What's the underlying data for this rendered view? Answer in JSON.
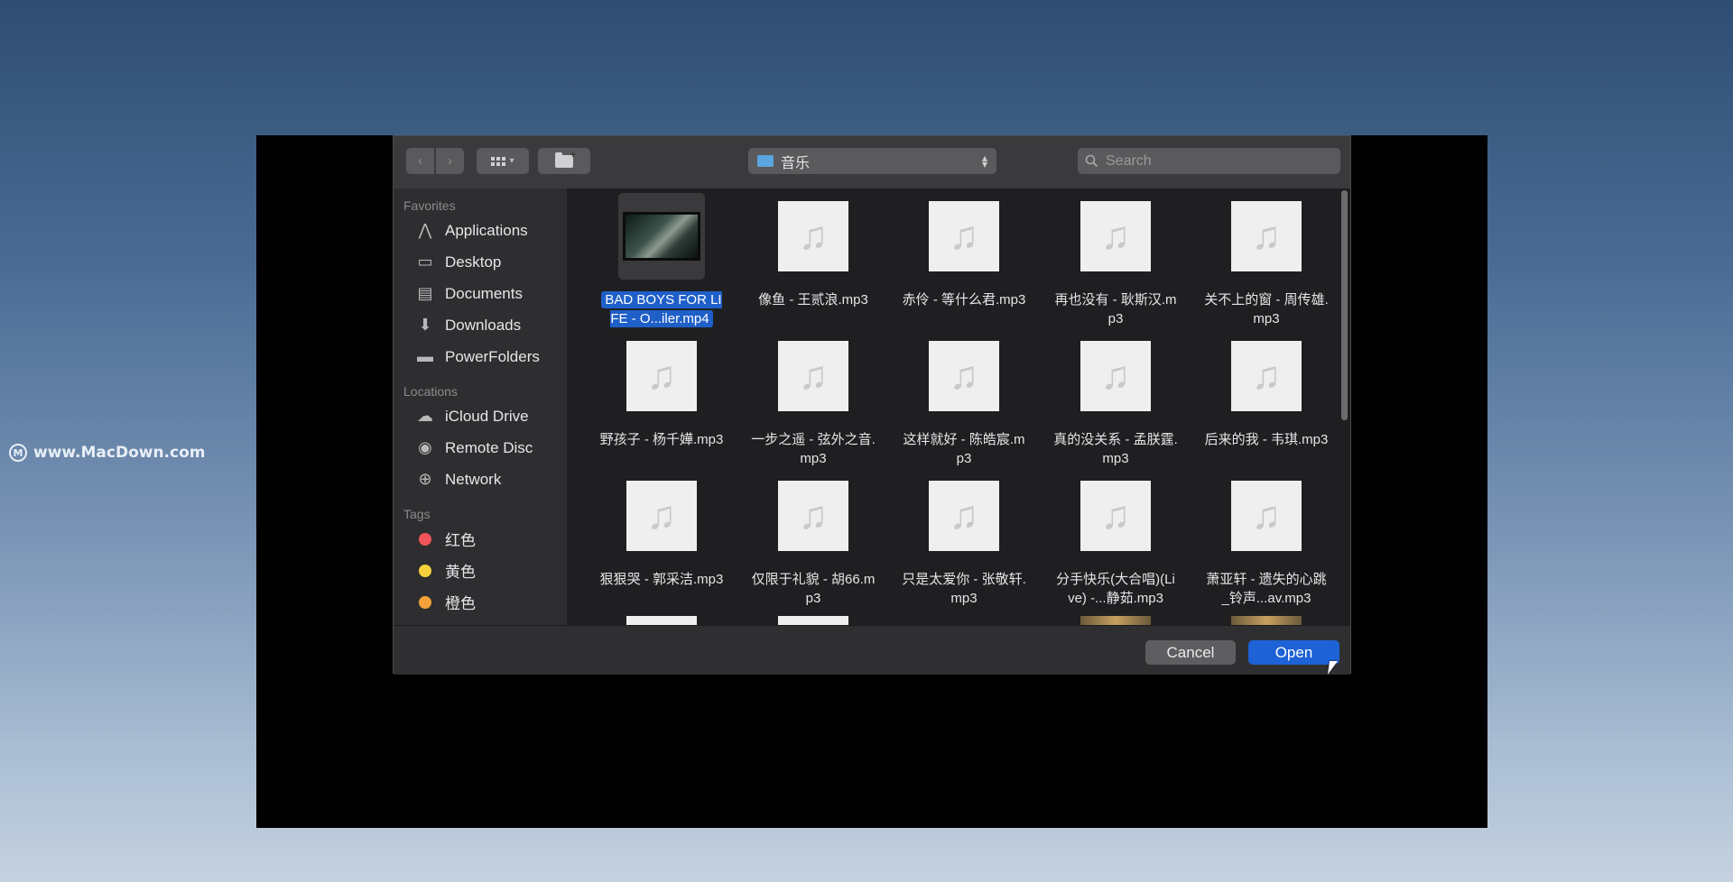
{
  "watermark": {
    "text": "www.MacDown.com"
  },
  "toolbar": {
    "path_label": "音乐",
    "search_placeholder": "Search"
  },
  "sidebar": {
    "favorites_title": "Favorites",
    "favorites": [
      {
        "label": "Applications",
        "icon": "applications-icon"
      },
      {
        "label": "Desktop",
        "icon": "desktop-icon"
      },
      {
        "label": "Documents",
        "icon": "documents-icon"
      },
      {
        "label": "Downloads",
        "icon": "downloads-icon"
      },
      {
        "label": "PowerFolders",
        "icon": "folder-icon"
      }
    ],
    "locations_title": "Locations",
    "locations": [
      {
        "label": "iCloud Drive",
        "icon": "cloud-icon"
      },
      {
        "label": "Remote Disc",
        "icon": "disc-icon"
      },
      {
        "label": "Network",
        "icon": "network-icon"
      }
    ],
    "tags_title": "Tags",
    "tags": [
      {
        "label": "红色",
        "color": "#f0555a"
      },
      {
        "label": "黄色",
        "color": "#f5d13a"
      },
      {
        "label": "橙色",
        "color": "#f5a23a"
      }
    ]
  },
  "files": [
    {
      "name": "BAD BOYS FOR LIFE - O...iler.mp4",
      "type": "video",
      "selected": true
    },
    {
      "name": "像鱼 - 王贰浪.mp3",
      "type": "audio"
    },
    {
      "name": "赤伶 - 等什么君.mp3",
      "type": "audio"
    },
    {
      "name": "再也没有 - 耿斯汉.mp3",
      "type": "audio"
    },
    {
      "name": "关不上的窗 - 周传雄.mp3",
      "type": "audio"
    },
    {
      "name": "野孩子 - 杨千嬅.mp3",
      "type": "audio"
    },
    {
      "name": "一步之遥 - 弦外之音.mp3",
      "type": "audio"
    },
    {
      "name": "这样就好 - 陈皓宸.mp3",
      "type": "audio"
    },
    {
      "name": "真的没关系 - 孟朕霆.mp3",
      "type": "audio"
    },
    {
      "name": "后来的我 - 韦琪.mp3",
      "type": "audio"
    },
    {
      "name": "狠狠哭 - 郭采洁.mp3",
      "type": "audio"
    },
    {
      "name": "仅限于礼貌 - 胡66.mp3",
      "type": "audio"
    },
    {
      "name": "只是太爱你 - 张敬轩.mp3",
      "type": "audio"
    },
    {
      "name": "分手快乐(大合唱)(Live) -...静茹.mp3",
      "type": "audio"
    },
    {
      "name": "萧亚轩 - 遗失的心跳_铃声...av.mp3",
      "type": "audio"
    }
  ],
  "buttons": {
    "cancel": "Cancel",
    "open": "Open"
  }
}
